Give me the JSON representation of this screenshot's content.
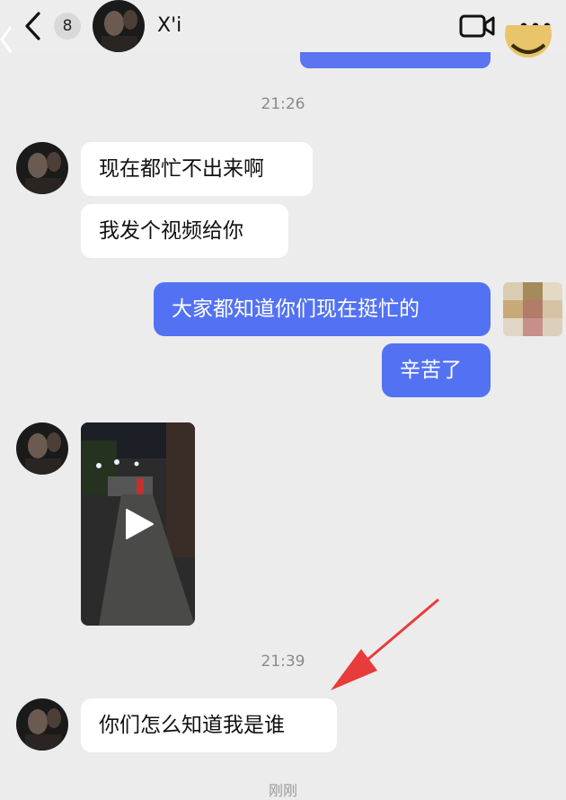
{
  "header": {
    "back_icon": "chevron-left-icon",
    "unread_count": "8",
    "contact_name": "X'i",
    "video_icon": "video-camera-icon",
    "more_icon": "more-dots-icon"
  },
  "messages": {
    "time_1": "21:26",
    "in_1": "现在都忙不出来啊",
    "in_2": "我发个视频给你",
    "out_1": "大家都知道你们现在挺忙的",
    "out_2": "辛苦了",
    "video_icon": "play-icon",
    "time_2": "21:39",
    "in_3": "你们怎么知道我是谁"
  },
  "footer": {
    "status": "刚刚"
  },
  "colors": {
    "outgoing_bubble": "#5372f3",
    "incoming_bubble": "#ffffff",
    "background": "#ececec",
    "annotation_arrow": "#e83b3b"
  }
}
